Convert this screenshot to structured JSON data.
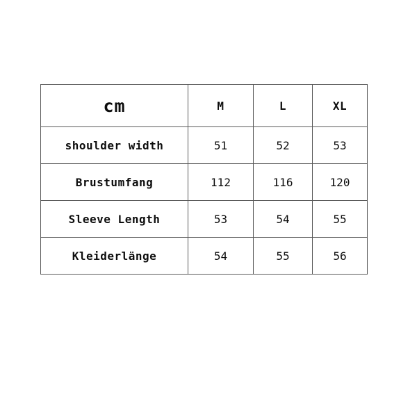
{
  "chart_data": {
    "type": "table",
    "title": "",
    "unit_label": "cm",
    "columns": [
      "cm",
      "M",
      "L",
      "XL"
    ],
    "categories": [
      "shoulder width",
      "Brustumfang",
      "Sleeve Length",
      "Kleiderlänge"
    ],
    "series": [
      {
        "name": "M",
        "values": [
          51,
          112,
          53,
          54
        ]
      },
      {
        "name": "L",
        "values": [
          52,
          116,
          54,
          55
        ]
      },
      {
        "name": "XL",
        "values": [
          53,
          120,
          55,
          56
        ]
      }
    ],
    "rows": [
      {
        "label": "shoulder width",
        "m": "51",
        "l": "52",
        "xl": "53"
      },
      {
        "label": "Brustumfang",
        "m": "112",
        "l": "116",
        "xl": "120"
      },
      {
        "label": "Sleeve Length",
        "m": "53",
        "l": "54",
        "xl": "55"
      },
      {
        "label": "Kleiderlänge",
        "m": "54",
        "l": "55",
        "xl": "56"
      }
    ],
    "grid": true,
    "legend": "none",
    "colors": {
      "background": "#ffffff",
      "border": "#5a5a5a",
      "text": "#0d0d0d"
    }
  },
  "table": {
    "header": {
      "unit": "cm",
      "size_m": "M",
      "size_l": "L",
      "size_xl": "XL"
    },
    "rows": [
      {
        "label": "shoulder width",
        "m": "51",
        "l": "52",
        "xl": "53"
      },
      {
        "label": "Brustumfang",
        "m": "112",
        "l": "116",
        "xl": "120"
      },
      {
        "label": "Sleeve Length",
        "m": "53",
        "l": "54",
        "xl": "55"
      },
      {
        "label": "Kleiderlänge",
        "m": "54",
        "l": "55",
        "xl": "56"
      }
    ]
  }
}
